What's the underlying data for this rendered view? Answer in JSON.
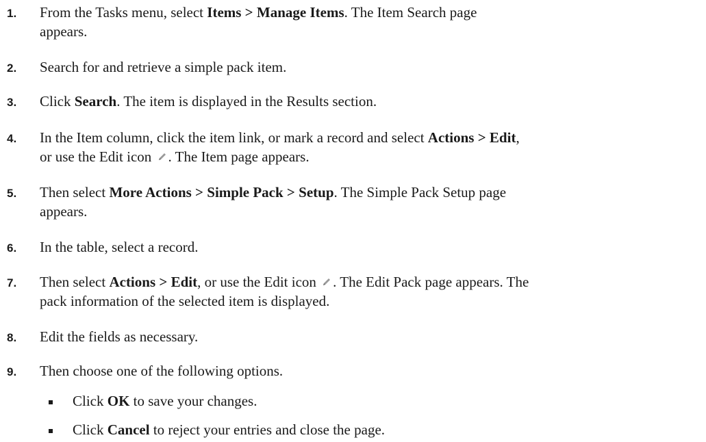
{
  "steps": [
    {
      "num": "1.",
      "segments": [
        {
          "t": "From the Tasks menu, select "
        },
        {
          "t": "Items > Manage Items",
          "b": true
        },
        {
          "t": ". The Item Search page"
        },
        {
          "br": true
        },
        {
          "t": "appears."
        }
      ]
    },
    {
      "num": "2.",
      "segments": [
        {
          "t": "Search for and retrieve a simple pack item."
        }
      ]
    },
    {
      "num": "3.",
      "segments": [
        {
          "t": "Click "
        },
        {
          "t": "Search",
          "b": true
        },
        {
          "t": ". The item is displayed in the Results section."
        }
      ]
    },
    {
      "num": "4.",
      "segments": [
        {
          "t": "In the Item column, click the item link, or mark a record and select "
        },
        {
          "t": "Actions > Edit",
          "b": true
        },
        {
          "t": ","
        },
        {
          "br": true
        },
        {
          "t": "or use the Edit icon "
        },
        {
          "icon": "pencil-icon"
        },
        {
          "t": ". The Item page appears."
        }
      ]
    },
    {
      "num": "5.",
      "segments": [
        {
          "t": "Then select "
        },
        {
          "t": "More Actions > Simple Pack > Setup",
          "b": true
        },
        {
          "t": ". The Simple Pack Setup page"
        },
        {
          "br": true
        },
        {
          "t": "appears."
        }
      ]
    },
    {
      "num": "6.",
      "segments": [
        {
          "t": "In the table, select a record."
        }
      ]
    },
    {
      "num": "7.",
      "segments": [
        {
          "t": "Then select "
        },
        {
          "t": "Actions > Edit",
          "b": true
        },
        {
          "t": ", or use the Edit icon "
        },
        {
          "icon": "pencil-icon"
        },
        {
          "t": ". The Edit Pack page appears. The"
        },
        {
          "br": true
        },
        {
          "t": "pack information of the selected item is displayed."
        }
      ]
    },
    {
      "num": "8.",
      "segments": [
        {
          "t": "Edit the fields as necessary."
        }
      ]
    },
    {
      "num": "9.",
      "segments": [
        {
          "t": "Then choose one of the following options."
        }
      ],
      "bullets": [
        {
          "segments": [
            {
              "t": "Click "
            },
            {
              "t": "OK",
              "b": true
            },
            {
              "t": " to save your changes."
            }
          ]
        },
        {
          "segments": [
            {
              "t": "Click "
            },
            {
              "t": "Cancel",
              "b": true
            },
            {
              "t": " to reject your entries and close the page."
            }
          ]
        }
      ]
    }
  ],
  "colors": {
    "text": "#1a1a1a",
    "icon": "#9a9a9a"
  }
}
